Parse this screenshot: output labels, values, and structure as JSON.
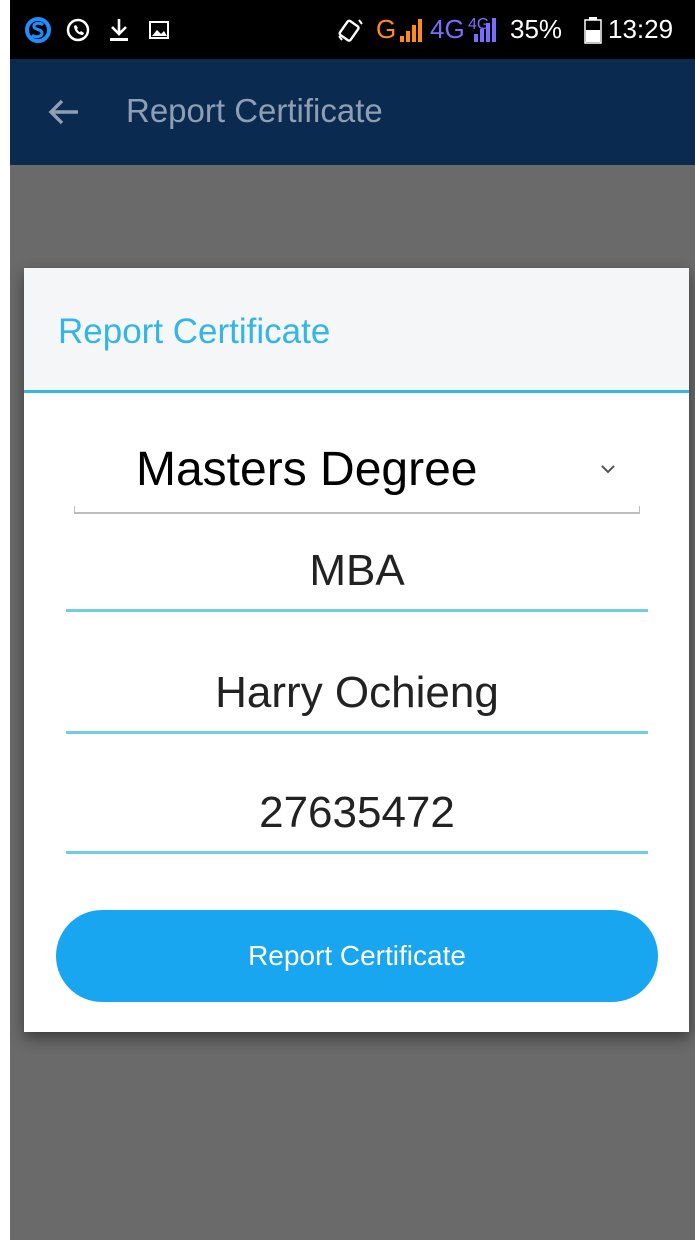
{
  "status_bar": {
    "network_label": "G",
    "network_4g_label": "4G",
    "network_4g_small": "4G",
    "battery_percent": "35%",
    "time": "13:29"
  },
  "app_bar": {
    "title": "Report Certificate"
  },
  "dialog": {
    "title": "Report Certificate",
    "degree_select": {
      "selected": "Masters Degree"
    },
    "course_field": {
      "value": "MBA"
    },
    "name_field": {
      "value": "Harry Ochieng"
    },
    "id_field": {
      "value": "27635472"
    },
    "submit_label": "Report Certificate"
  },
  "colors": {
    "status_bar_bg": "#000000",
    "app_bar_bg": "#0a2a50",
    "accent": "#33b5e5",
    "button_bg": "#17a6ef",
    "scrim": "#6a6a6a"
  }
}
